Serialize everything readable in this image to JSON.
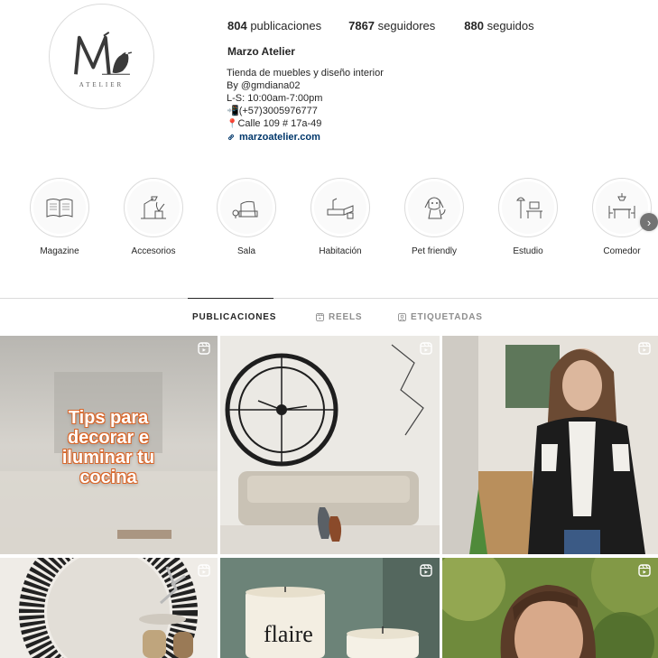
{
  "profile": {
    "logo_sub": "ATELIER",
    "stats": {
      "posts_count": "804",
      "posts_label": "publicaciones",
      "followers_count": "7867",
      "followers_label": "seguidores",
      "following_count": "880",
      "following_label": "seguidos"
    },
    "name": "Marzo Atelier",
    "bio": {
      "line1": "Tienda de muebles y diseño interior",
      "line2": "By @gmdiana02",
      "line3": "L-S: 10:00am-7:00pm",
      "line4": "(+57)3005976777",
      "line5": "Calle 109 # 17a-49",
      "link": "marzoatelier.com"
    }
  },
  "highlights": [
    {
      "label": "Magazine",
      "icon": "book-icon"
    },
    {
      "label": "Accesorios",
      "icon": "lamp-plant-icon"
    },
    {
      "label": "Sala",
      "icon": "armchair-icon"
    },
    {
      "label": "Habitación",
      "icon": "bed-icon"
    },
    {
      "label": "Pet friendly",
      "icon": "dog-icon"
    },
    {
      "label": "Estudio",
      "icon": "desk-icon"
    },
    {
      "label": "Comedor",
      "icon": "dining-table-icon"
    }
  ],
  "tabs": [
    {
      "label": "PUBLICACIONES",
      "icon": "grid-icon",
      "active": true
    },
    {
      "label": "REELS",
      "icon": "reels-icon",
      "active": false
    },
    {
      "label": "ETIQUETADAS",
      "icon": "tagged-icon",
      "active": false
    }
  ],
  "posts": [
    {
      "overlay_lines": [
        "Tips para",
        "decorar e",
        "iluminar tu",
        "cocina"
      ],
      "reel": true
    },
    {
      "reel": true
    },
    {
      "reel": true
    },
    {
      "reel": true
    },
    {
      "product_text": "flaire",
      "reel": true
    },
    {
      "reel": true
    }
  ],
  "colors": {
    "link": "#00376b",
    "text": "#262626",
    "muted": "#8e8e8e",
    "divider": "#dbdbdb",
    "accent_orange": "#d9672b"
  }
}
